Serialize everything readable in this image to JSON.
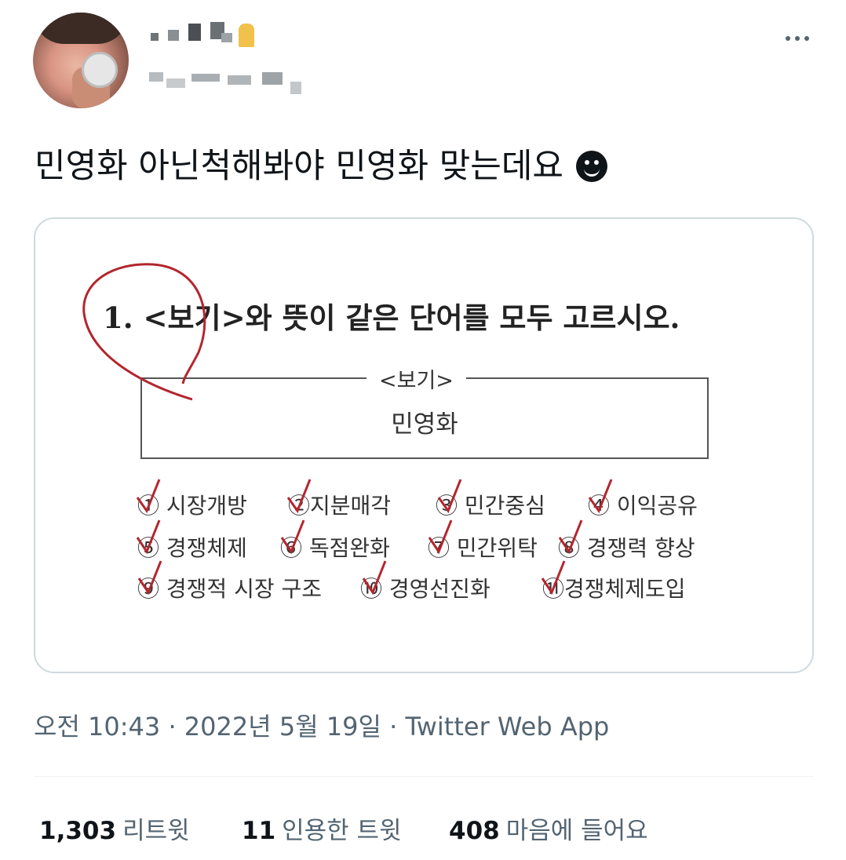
{
  "tweet": {
    "text": "민영화 아닌척해봐야 민영화 맞는데요",
    "emoji": "smiling-face-emoji",
    "timestamp": "오전 10:43 · 2022년 5월 19일 · Twitter Web App"
  },
  "quiz": {
    "question": "1. <보기>와 뜻이 같은 단어를 모두 고르시오.",
    "box_title": "<보기>",
    "box_word": "민영화",
    "options": [
      "① 시장개방",
      "②지분매각",
      "③ 민간중심",
      "④ 이익공유",
      "⑤ 경쟁체제",
      "⑥ 독점완화",
      "⑦ 민간위탁",
      "⑧ 경쟁력 향상",
      "⑨ 경쟁적 시장 구조",
      "⑩ 경영선진화",
      "⑪경쟁체제도입"
    ]
  },
  "stats": {
    "retweets_count": "1,303",
    "retweets_label": "리트윗",
    "quotes_count": "11",
    "quotes_label": "인용한 트윗",
    "likes_count": "408",
    "likes_label": "마음에 들어요"
  },
  "colors": {
    "text": "#0f1419",
    "muted": "#536471",
    "border": "#cfd9de",
    "mark": "#b3262e"
  }
}
